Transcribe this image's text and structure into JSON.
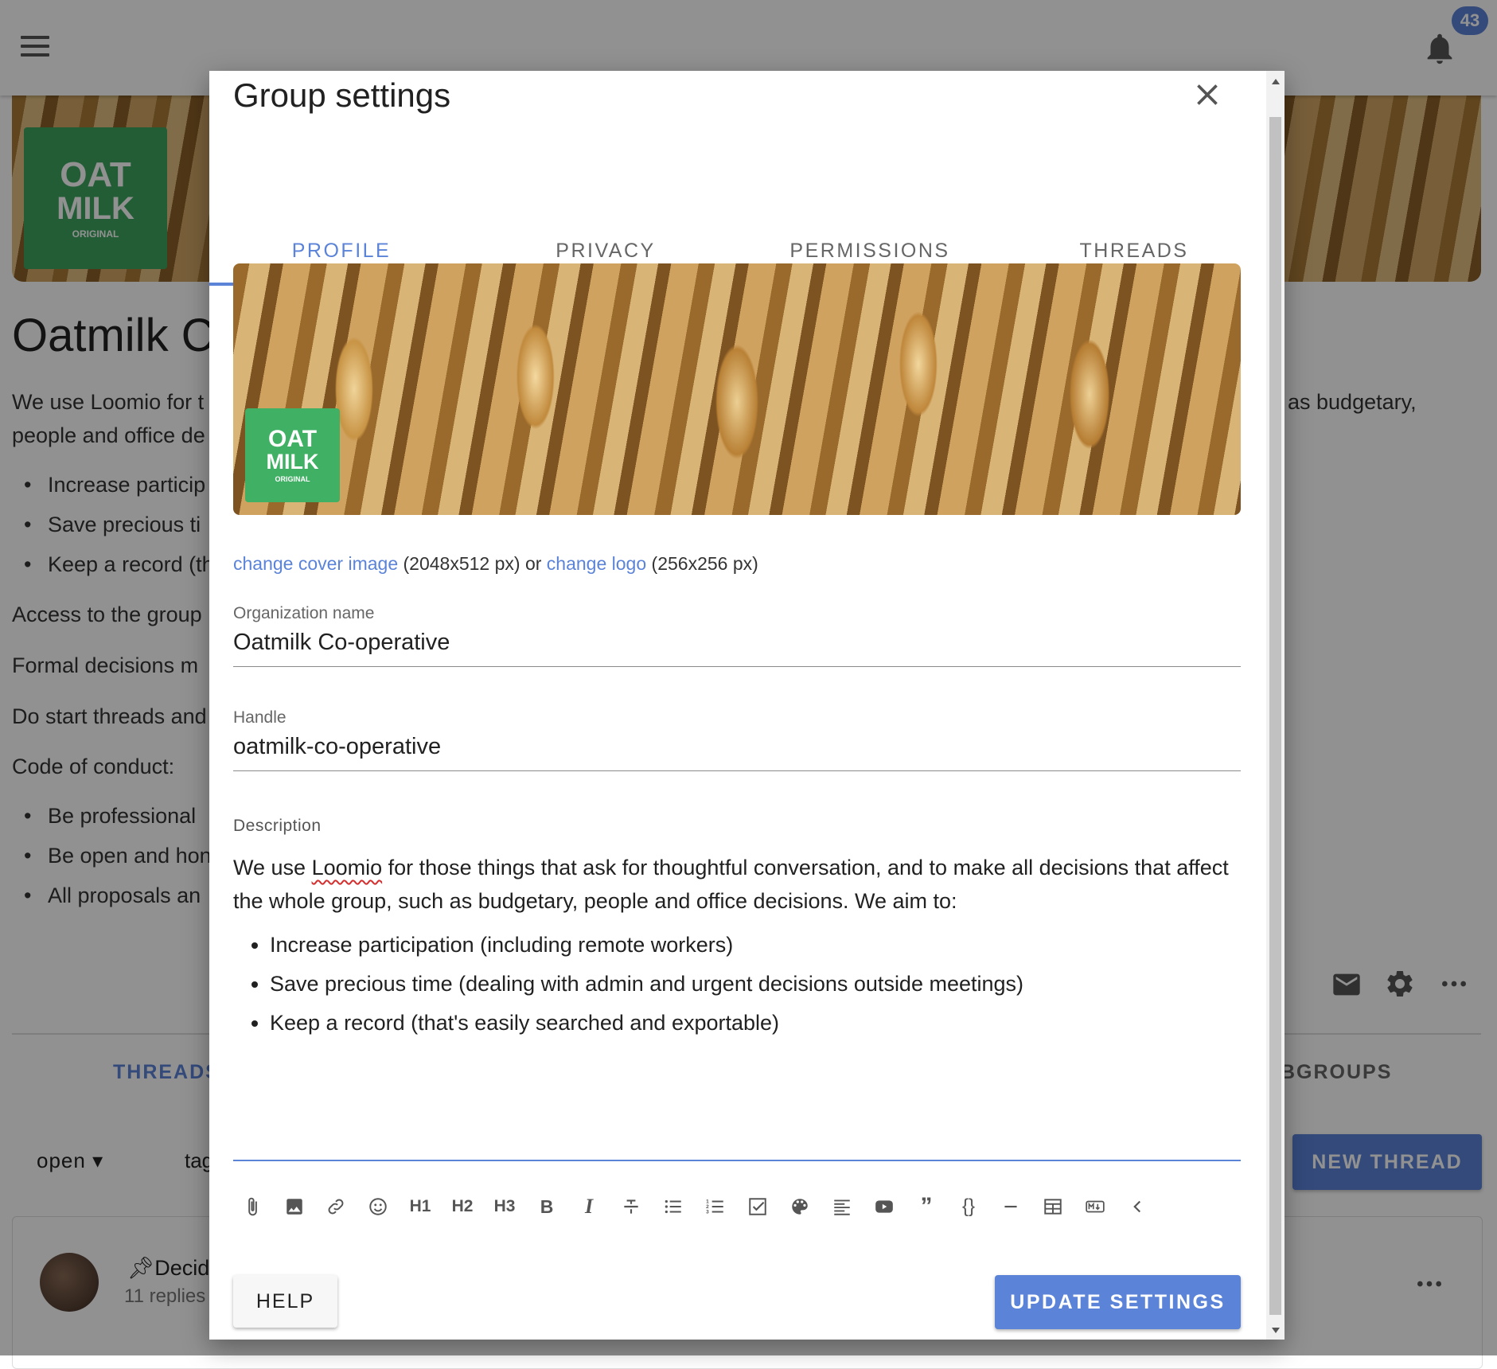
{
  "app": {
    "notification_count": "43"
  },
  "background": {
    "group_title": "Oatmilk C",
    "intro_line1_left": "We use Loomio for t",
    "intro_line1_right": "as budgetary,",
    "intro_line2": "people and office de",
    "bullets": [
      "Increase particip",
      "Save precious ti",
      "Keep a record (th"
    ],
    "para1": "Access to the group",
    "para2": "Formal decisions m",
    "para3": "Do start threads and",
    "para4": "Code of conduct:",
    "conduct_bullets": [
      "Be professional",
      "Be open and hon",
      "All proposals an"
    ],
    "tab_threads": "THREADS",
    "tab_subgroups": "BGROUPS",
    "filter_open": "open",
    "filter_tags": "tag",
    "new_thread_label": "NEW THREAD",
    "thread_title": "Decidi",
    "thread_replies": "11 replies"
  },
  "dialog": {
    "title": "Group settings",
    "tabs": [
      {
        "label": "PROFILE",
        "active": true
      },
      {
        "label": "PRIVACY",
        "active": false
      },
      {
        "label": "PERMISSIONS",
        "active": false
      },
      {
        "label": "THREADS",
        "active": false
      }
    ],
    "logo_text": {
      "line1": "OAT",
      "line2": "MILK",
      "line3": "ORIGINAL"
    },
    "image_links": {
      "change_cover": "change cover image",
      "cover_size": " (2048x512 px) or ",
      "change_logo": "change logo",
      "logo_size": " (256x256 px)"
    },
    "org_name": {
      "label": "Organization name",
      "value": "Oatmilk Co-operative"
    },
    "handle": {
      "label": "Handle",
      "value": "oatmilk-co-operative"
    },
    "description": {
      "label": "Description",
      "p_before": "We use ",
      "p_word": "Loomio",
      "p_after": " for those things that ask for thoughtful conversation, and to make all decisions that affect the whole group, such as budgetary, people and office decisions. We aim to:",
      "items": [
        "Increase participation (including remote workers)",
        "Save precious time (dealing with admin and urgent decisions outside meetings)",
        "Keep a record (that's easily searched and exportable)"
      ]
    },
    "toolbar": {
      "h1": "H1",
      "h2": "H2",
      "h3": "H3",
      "bold": "B",
      "italic": "I",
      "code": "{}",
      "quote": "”"
    },
    "help_label": "HELP",
    "update_label": "UPDATE SETTINGS"
  },
  "colors": {
    "accent": "#5b83d8",
    "logo_green": "#3fb064"
  }
}
